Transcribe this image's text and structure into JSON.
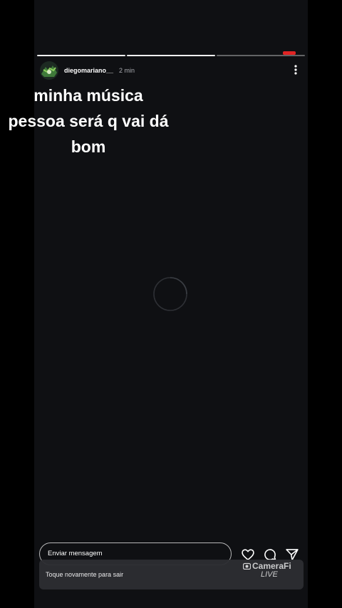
{
  "story": {
    "username": "diegomariano__",
    "time": "2 min",
    "segments_total": 3,
    "segments_done": 2
  },
  "caption": {
    "lines": [
      "minha música",
      "pessoa será q vai dá",
      "bom"
    ]
  },
  "reply": {
    "placeholder": "Enviar mensagem"
  },
  "toast": {
    "text": "Toque novamente para sair"
  },
  "watermark": {
    "brand": "CameraFi",
    "sub": "LIVE"
  },
  "icons": {
    "more": "more-vertical-icon",
    "like": "heart-icon",
    "comment": "comment-icon",
    "share": "send-icon",
    "loading": "loading-spinner-icon"
  },
  "colors": {
    "background": "#0f1013",
    "text": "#ffffff",
    "muted": "#a9abb0",
    "record": "#e02424"
  }
}
